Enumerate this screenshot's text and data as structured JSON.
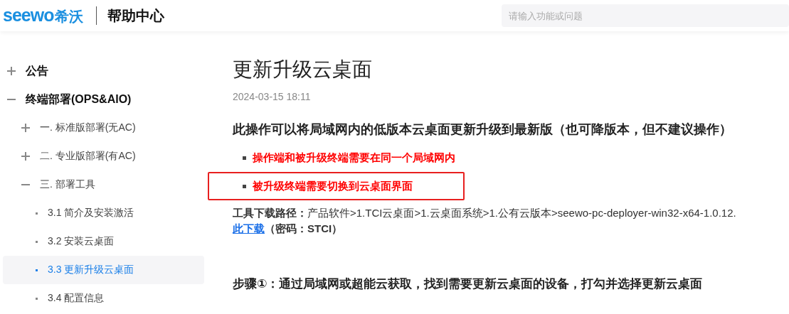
{
  "header": {
    "logo_latin": "seewo",
    "logo_cn": "希沃",
    "title": "帮助中心",
    "search": {
      "placeholder": "请输入功能或问题"
    }
  },
  "sidebar": {
    "items": [
      {
        "label": "公告",
        "expanded": false
      },
      {
        "label": "终端部署(OPS&AIO)",
        "expanded": true,
        "children": [
          {
            "label": "一. 标准版部署(无AC)",
            "expanded": false
          },
          {
            "label": "二. 专业版部署(有AC)",
            "expanded": false
          },
          {
            "label": "三. 部署工具",
            "expanded": true,
            "children": [
              {
                "label": "3.1 简介及安装激活",
                "selected": false
              },
              {
                "label": "3.2 安装云桌面",
                "selected": false
              },
              {
                "label": "3.3 更新升级云桌面",
                "selected": true
              },
              {
                "label": "3.4 配置信息",
                "selected": false
              }
            ]
          }
        ]
      }
    ]
  },
  "article": {
    "title": "更新升级云桌面",
    "date": "2024-03-15 18:11",
    "intro": "此操作可以将局域网内的低版本云桌面更新升级到最新版（也可降版本，但不建议操作）",
    "bullets": [
      {
        "text": "操作端和被升级终端需要在同一个局域网内",
        "highlighted": false
      },
      {
        "text": "被升级终端需要切换到云桌面界面",
        "highlighted": true
      }
    ],
    "path_label": "工具下载路径：",
    "path": "产品软件>1.TCI云桌面>1.云桌面系统>1.公有云版本>seewo-pc-deployer-win32-x64-1.0.12.",
    "download_link": "此下载",
    "password": "（密码：STCI）",
    "step": "步骤①：通过局域网或超能云获取，找到需要更新云桌面的设备，打勾并选择更新云桌面"
  }
}
